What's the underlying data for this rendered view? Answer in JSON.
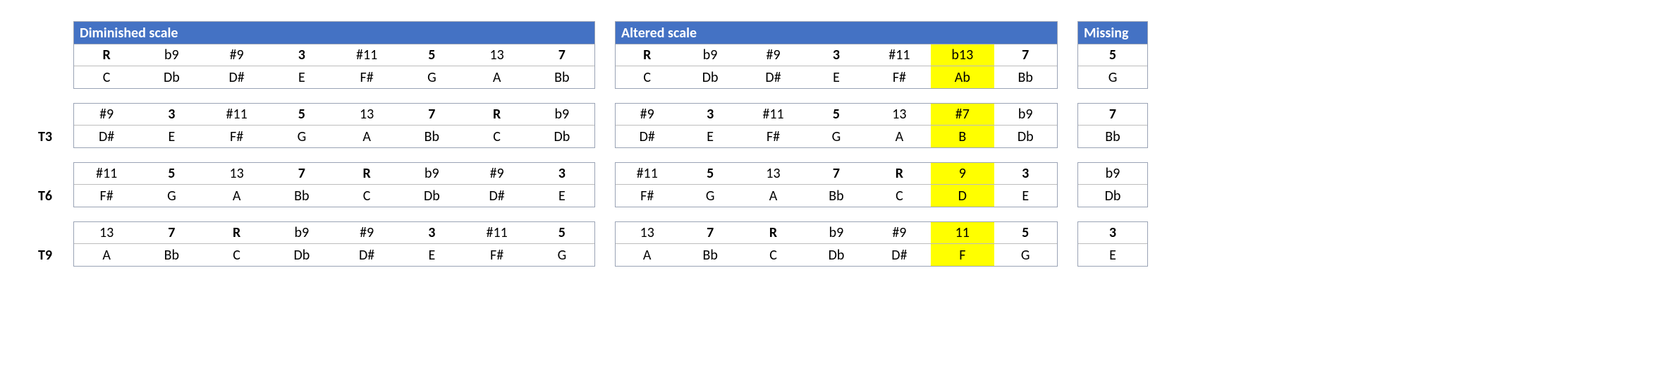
{
  "colors": {
    "header_bg": "#4472c4",
    "highlight_bg": "#ffff00",
    "border": "#9aa3b5"
  },
  "bold_degrees": [
    "R",
    "3",
    "5",
    "7"
  ],
  "row_labels": [
    "",
    "T3",
    "T6",
    "T9"
  ],
  "sections": {
    "diminished": {
      "title": "Diminished scale",
      "rows": [
        {
          "degrees": [
            "R",
            "b9",
            "#9",
            "3",
            "#11",
            "5",
            "13",
            "7"
          ],
          "notes": [
            "C",
            "Db",
            "D#",
            "E",
            "F#",
            "G",
            "A",
            "Bb"
          ],
          "highlight": []
        },
        {
          "degrees": [
            "#9",
            "3",
            "#11",
            "5",
            "13",
            "7",
            "R",
            "b9"
          ],
          "notes": [
            "D#",
            "E",
            "F#",
            "G",
            "A",
            "Bb",
            "C",
            "Db"
          ],
          "highlight": []
        },
        {
          "degrees": [
            "#11",
            "5",
            "13",
            "7",
            "R",
            "b9",
            "#9",
            "3"
          ],
          "notes": [
            "F#",
            "G",
            "A",
            "Bb",
            "C",
            "Db",
            "D#",
            "E"
          ],
          "highlight": []
        },
        {
          "degrees": [
            "13",
            "7",
            "R",
            "b9",
            "#9",
            "3",
            "#11",
            "5"
          ],
          "notes": [
            "A",
            "Bb",
            "C",
            "Db",
            "D#",
            "E",
            "F#",
            "G"
          ],
          "highlight": []
        }
      ]
    },
    "altered": {
      "title": "Altered scale",
      "rows": [
        {
          "degrees": [
            "R",
            "b9",
            "#9",
            "3",
            "#11",
            "b13",
            "7"
          ],
          "notes": [
            "C",
            "Db",
            "D#",
            "E",
            "F#",
            "Ab",
            "Bb"
          ],
          "highlight": [
            5
          ]
        },
        {
          "degrees": [
            "#9",
            "3",
            "#11",
            "5",
            "13",
            "#7",
            "b9"
          ],
          "notes": [
            "D#",
            "E",
            "F#",
            "G",
            "A",
            "B",
            "Db"
          ],
          "highlight": [
            5
          ]
        },
        {
          "degrees": [
            "#11",
            "5",
            "13",
            "7",
            "R",
            "9",
            "3"
          ],
          "notes": [
            "F#",
            "G",
            "A",
            "Bb",
            "C",
            "D",
            "E"
          ],
          "highlight": [
            5
          ]
        },
        {
          "degrees": [
            "13",
            "7",
            "R",
            "b9",
            "#9",
            "11",
            "5"
          ],
          "notes": [
            "A",
            "Bb",
            "C",
            "Db",
            "D#",
            "F",
            "G"
          ],
          "highlight": [
            5
          ]
        }
      ]
    },
    "missing": {
      "title": "Missing",
      "rows": [
        {
          "degree": "5",
          "note": "G"
        },
        {
          "degree": "7",
          "note": "Bb"
        },
        {
          "degree": "b9",
          "note": "Db"
        },
        {
          "degree": "3",
          "note": "E"
        }
      ]
    }
  }
}
